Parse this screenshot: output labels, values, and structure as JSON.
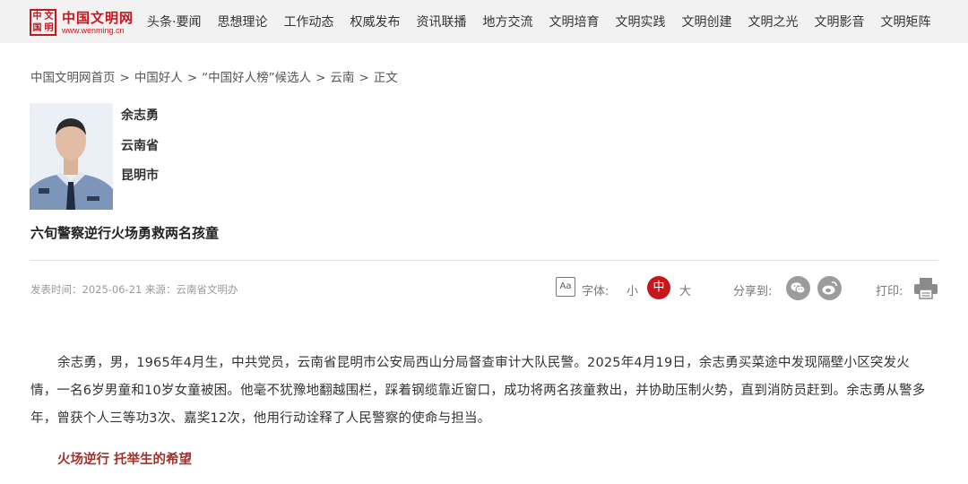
{
  "header": {
    "logo_seal_chars": [
      "中",
      "文",
      "国",
      "明"
    ],
    "logo_title": "中国文明网",
    "logo_url": "www.wenming.cn",
    "nav": [
      "头条·要闻",
      "思想理论",
      "工作动态",
      "权威发布",
      "资讯联播",
      "地方交流",
      "文明培育",
      "文明实践",
      "文明创建",
      "文明之光",
      "文明影音",
      "文明矩阵"
    ]
  },
  "breadcrumb": [
    "中国文明网首页",
    "中国好人",
    "“中国好人榜”候选人",
    "云南",
    "正文"
  ],
  "breadcrumb_sep": ">",
  "profile": {
    "name": "余志勇",
    "province": "云南省",
    "city": "昆明市"
  },
  "headline": "六旬警察逆行火场勇救两名孩童",
  "meta": {
    "info": "发表时间：2025-06-21 来源：云南省文明办",
    "font_icon_text": "Aa",
    "font_label": "字体:",
    "size_small": "小",
    "size_medium": "中",
    "size_large": "大",
    "share_label": "分享到:",
    "print_label": "打印:"
  },
  "article": {
    "paragraph": "余志勇，男，1965年4月生，中共党员，云南省昆明市公安局西山分局督查审计大队民警。2025年4月19日，余志勇买菜途中发现隔壁小区突发火情，一名6岁男童和10岁女童被困。他毫不犹豫地翻越围栏，踩着钢缆靠近窗口，成功将两名孩童救出，并协助压制火势，直到消防员赶到。余志勇从警多年，曾获个人三等功3次、嘉奖12次，他用行动诠释了人民警察的使命与担当。",
    "subheading": "火场逆行 托举生的希望"
  },
  "colors": {
    "brand_red": "#c8161d",
    "subheading": "#a0322e",
    "header_bg": "#f2f2f2"
  },
  "icons": [
    "logo-seal",
    "font-size-icon",
    "wechat-icon",
    "weibo-icon",
    "printer-icon"
  ]
}
